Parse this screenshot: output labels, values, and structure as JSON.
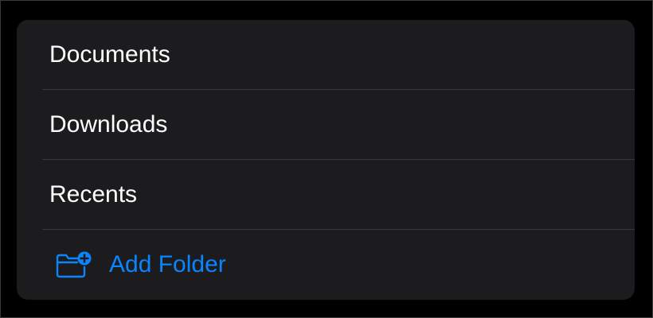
{
  "menu": {
    "items": [
      {
        "label": "Documents"
      },
      {
        "label": "Downloads"
      },
      {
        "label": "Recents"
      }
    ],
    "add_folder": {
      "label": "Add Folder",
      "icon": "folder-badge-plus-icon",
      "color": "#0a84ff"
    }
  },
  "colors": {
    "panel_background": "#1c1c1e",
    "separator": "#38383a",
    "text": "#ffffff",
    "accent": "#0a84ff"
  }
}
